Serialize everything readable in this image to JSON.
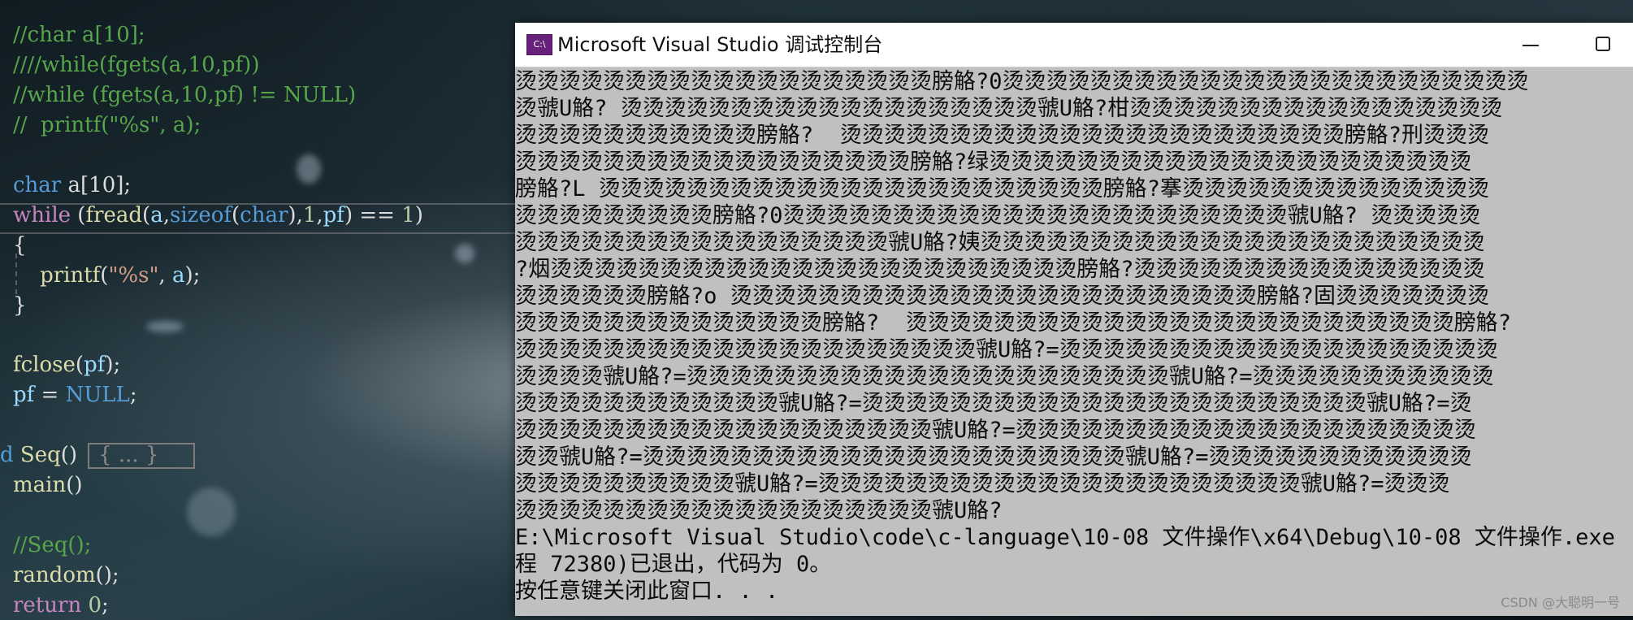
{
  "editor": {
    "lines": [
      {
        "kind": "comment",
        "text": "//char a[10];"
      },
      {
        "kind": "comment",
        "text": "////while(fgets(a,10,pf))"
      },
      {
        "kind": "comment",
        "text": "//while (fgets(a,10,pf) != NULL)"
      },
      {
        "kind": "comment",
        "text": "//  printf(\"%s\", a);"
      },
      {
        "kind": "decl",
        "type": "char",
        "rest": " a[10];"
      },
      {
        "kind": "while",
        "kw": "while",
        "p1": " (",
        "fn": "fread",
        "p2": "(",
        "v1": "a",
        "c1": ",",
        "kw2": "sizeof",
        "p3": "(",
        "t": "char",
        "p4": "),",
        "n1": "1",
        "c2": ",",
        "v2": "pf",
        "p5": ") == ",
        "n2": "1",
        "p6": ")"
      },
      {
        "kind": "plain",
        "text": "{"
      },
      {
        "kind": "printf",
        "indent": "    ",
        "fn": "printf",
        "p1": "(",
        "str": "\"%s\"",
        "p2": ", ",
        "v": "a",
        "p3": ");"
      },
      {
        "kind": "plain",
        "text": "}"
      },
      {
        "kind": "call",
        "fn": "fclose",
        "p1": "(",
        "v": "pf",
        "p2": ");"
      },
      {
        "kind": "assign",
        "v": "pf",
        "mid": " = ",
        "k": "NULL",
        "end": ";"
      },
      {
        "kind": "func",
        "prefix": "d ",
        "name": "Seq",
        "paren": "()",
        "collapsed": "{ ... }"
      },
      {
        "kind": "func2",
        "name": "main",
        "paren": "()"
      },
      {
        "kind": "comment",
        "text": "//Seq();"
      },
      {
        "kind": "call0",
        "fn": "random",
        "paren": "();"
      },
      {
        "kind": "ret",
        "kw": "return",
        "sp": " ",
        "n": "0",
        "end": ";"
      }
    ]
  },
  "console": {
    "app_icon_label": "C:\\",
    "title": "Microsoft Visual Studio 调试控制台",
    "output_lines": [
      "烫烫烫烫烫烫烫烫烫烫烫烫烫烫烫烫烫烫烫膀觡?0烫烫烫烫烫烫烫烫烫烫烫烫烫烫烫烫烫烫烫烫烫烫烫烫",
      "烫虢U觡? 烫烫烫烫烫烫烫烫烫烫烫烫烫烫烫烫烫烫烫虢U觡?柑烫烫烫烫烫烫烫烫烫烫烫烫烫烫烫烫烫",
      "烫烫烫烫烫烫烫烫烫烫烫膀觡?  烫烫烫烫烫烫烫烫烫烫烫烫烫烫烫烫烫烫烫烫烫烫烫膀觡?刑烫烫烫",
      "烫烫烫烫烫烫烫烫烫烫烫烫烫烫烫烫烫烫膀觡?绿烫烫烫烫烫烫烫烫烫烫烫烫烫烫烫烫烫烫烫烫烫烫",
      "膀觡?L 烫烫烫烫烫烫烫烫烫烫烫烫烫烫烫烫烫烫烫烫烫烫烫膀觡?搴烫烫烫烫烫烫烫烫烫烫烫烫烫烫",
      "烫烫烫烫烫烫烫烫烫膀觡?0烫烫烫烫烫烫烫烫烫烫烫烫烫烫烫烫烫烫烫烫烫烫烫虢U觡? 烫烫烫烫烫",
      "烫烫烫烫烫烫烫烫烫烫烫烫烫烫烫烫烫虢U觡?姨烫烫烫烫烫烫烫烫烫烫烫烫烫烫烫烫烫烫烫烫烫烫烫",
      "?烟烫烫烫烫烫烫烫烫烫烫烫烫烫烫烫烫烫烫烫烫烫烫烫烫膀觡?烫烫烫烫烫烫烫烫烫烫烫烫烫烫烫烫",
      "烫烫烫烫烫烫膀觡?o 烫烫烫烫烫烫烫烫烫烫烫烫烫烫烫烫烫烫烫烫烫烫烫烫膀觡?固烫烫烫烫烫烫烫",
      "烫烫烫烫烫烫烫烫烫烫烫烫烫烫膀觡?  烫烫烫烫烫烫烫烫烫烫烫烫烫烫烫烫烫烫烫烫烫烫烫烫烫膀觡?",
      "烫烫烫烫烫烫烫烫烫烫烫烫烫烫烫烫烫烫烫烫烫虢U觡?=烫烫烫烫烫烫烫烫烫烫烫烫烫烫烫烫烫烫烫烫",
      "烫烫烫烫虢U觡?=烫烫烫烫烫烫烫烫烫烫烫烫烫烫烫烫烫烫烫烫烫烫虢U觡?=烫烫烫烫烫烫烫烫烫烫烫",
      "烫烫烫烫烫烫烫烫烫烫烫烫虢U觡?=烫烫烫烫烫烫烫烫烫烫烫烫烫烫烫烫烫烫烫烫烫烫烫虢U觡?=烫",
      "烫烫烫烫烫烫烫烫烫烫烫烫烫烫烫烫烫烫烫虢U觡?=烫烫烫烫烫烫烫烫烫烫烫烫烫烫烫烫烫烫烫烫烫",
      "烫烫虢U觡?=烫烫烫烫烫烫烫烫烫烫烫烫烫烫烫烫烫烫烫烫烫烫虢U觡?=烫烫烫烫烫烫烫烫烫烫烫烫",
      "烫烫烫烫烫烫烫烫烫烫虢U觡?=烫烫烫烫烫烫烫烫烫烫烫烫烫烫烫烫烫烫烫烫烫烫虢U觡?=烫烫烫",
      "烫烫烫烫烫烫烫烫烫烫烫烫烫烫烫烫烫烫烫虢U觡?",
      "E:\\Microsoft Visual Studio\\code\\c-language\\10-08 文件操作\\x64\\Debug\\10-08 文件操作.exe",
      "程 72380)已退出，代码为 0。",
      "按任意键关闭此窗口. . ."
    ]
  },
  "watermark": "CSDN @大聪明一号"
}
